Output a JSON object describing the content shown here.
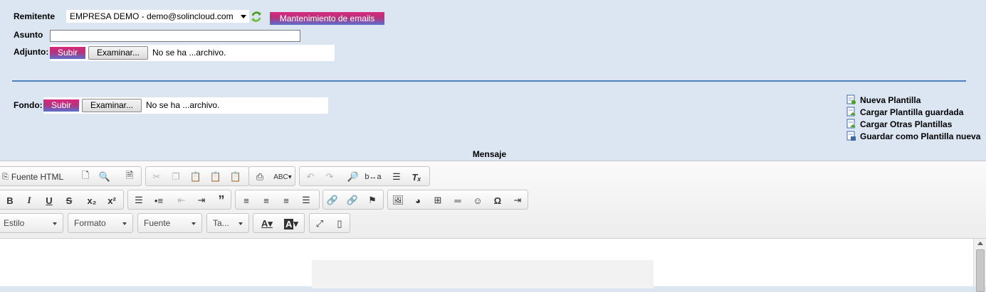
{
  "form": {
    "remitente_label": "Remitente",
    "remitente_value": "EMPRESA DEMO - demo@solincloud.com",
    "mantenimiento_button": "Mantenimiento de emails",
    "asunto_label": "Asunto",
    "asunto_value": "",
    "adjunto_label": "Adjunto:",
    "fondo_label": "Fondo:",
    "subir_label": "Subir",
    "examinar_label": "Examinar...",
    "no_file_text": "No se ha ...archivo."
  },
  "templates": [
    {
      "label": "Nueva Plantilla",
      "icon": "new-template-icon"
    },
    {
      "label": "Cargar Plantilla guardada",
      "icon": "load-template-icon"
    },
    {
      "label": "Cargar Otras Plantillas",
      "icon": "load-other-templates-icon"
    },
    {
      "label": "Guardar como Plantilla nueva",
      "icon": "save-template-icon"
    }
  ],
  "editor": {
    "title": "Mensaje",
    "source_button": "Fuente HTML",
    "combos": {
      "style": "Estilo",
      "format": "Formato",
      "font": "Fuente",
      "size": "Ta..."
    }
  },
  "colors": {
    "background": "#dce6f2",
    "accent_gradient_top": "#d8287e",
    "accent_gradient_bottom": "#5a6fd0",
    "divider": "#4f81bd"
  }
}
